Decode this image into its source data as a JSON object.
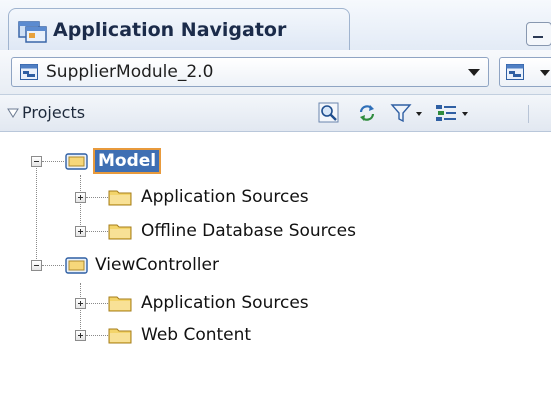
{
  "window": {
    "tab_title": "Application Navigator",
    "tab_icon": "application-navigator-icon"
  },
  "application_bar": {
    "selected_application": "SupplierModule_2.0",
    "app_icon": "application-icon",
    "menu_icon": "application-menu-icon"
  },
  "projects_panel": {
    "header_label": "Projects",
    "toolbar_icons": [
      "find-icon",
      "refresh-icon",
      "filter-icon",
      "working-sets-icon"
    ]
  },
  "tree": {
    "model": {
      "label": "Model",
      "expanded": true,
      "selected": true,
      "children": [
        {
          "label": "Application Sources",
          "expanded": false
        },
        {
          "label": "Offline Database Sources",
          "expanded": false
        }
      ]
    },
    "view_controller": {
      "label": "ViewController",
      "expanded": true,
      "selected": false,
      "children": [
        {
          "label": "Application Sources",
          "expanded": false
        },
        {
          "label": "Web Content",
          "expanded": false
        }
      ]
    }
  },
  "colors": {
    "selection_fill": "#3f6fb3",
    "selection_outline": "#e89a3c",
    "folder_yellow": "#f3d46a",
    "project_blue": "#4b7fc7"
  }
}
